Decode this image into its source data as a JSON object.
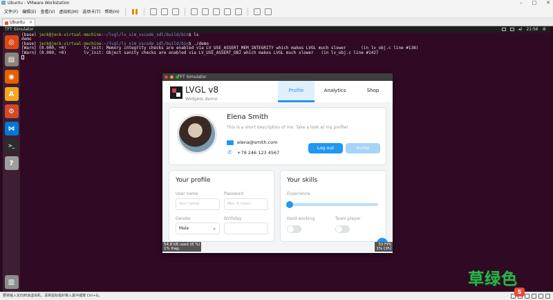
{
  "vmware": {
    "title": "Ubuntu - VMware Workstation",
    "menu": [
      "文件(F)",
      "编辑(E)",
      "查看(V)",
      "虚拟机(M)",
      "选项卡(T)",
      "帮助(H)"
    ],
    "tab_label": "Ubuntu",
    "status_text": "要将输入定向到该虚拟机，请将鼠标指针移入其中或按 Ctrl+G。",
    "watermark": "草绿色",
    "ime_label": "S"
  },
  "ubuntu_panel": {
    "window_title": "TFT Simulator",
    "clock": "21:56"
  },
  "launcher": {
    "items": [
      {
        "name": "ubuntu-dash-icon",
        "color": "#dd4814",
        "glyph": "◎"
      },
      {
        "name": "files-icon",
        "color": "#8c8479",
        "glyph": "▤"
      },
      {
        "name": "firefox-icon",
        "color": "#e66000",
        "glyph": "◉"
      },
      {
        "name": "software-center-icon",
        "color": "#f5a623",
        "glyph": "A"
      },
      {
        "name": "settings-icon",
        "color": "#d14a2a",
        "glyph": "⚙"
      },
      {
        "name": "vscode-icon",
        "color": "#0078d7",
        "glyph": "⋈"
      },
      {
        "name": "terminal-icon",
        "color": "#2c2c2c",
        "glyph": ">_"
      },
      {
        "name": "help-icon",
        "color": "#9e9e9e",
        "glyph": "?"
      }
    ]
  },
  "terminal": {
    "line1_prompt": "(base) ",
    "line1_user": "jeck@jeck-virtual-machine",
    "line1_path": ":~/lvgl/lv_sim_vscode_sdl/build/bin",
    "line1_cmd": "$ ls",
    "line2": "demo",
    "line3_prompt": "(base) ",
    "line3_user": "jeck@jeck-virtual-machine",
    "line3_path": ":~/lvgl/lv_sim_vscode_sdl/build/bin",
    "line3_cmd": "$ ./demo",
    "line4": "[Warn] (0.000, +0)       lv_init: Memory integrity checks are enabled via LV_USE_ASSERT_MEM_INTEGRITY which makes LVGL much slower      (in lv_obj.c line #138)",
    "line5": "[Warn] (0.000, +0)       lv_init: Object sanity checks are enabled via LV_USE_ASSERT_OBJ which makes LVGL much slower   (in lv_obj.c line #142)"
  },
  "simulator": {
    "title": "TFT Simulator",
    "header": {
      "title": "LVGL v8",
      "subtitle": "Widgets demo",
      "tabs": [
        "Profile",
        "Analytics",
        "Shop"
      ]
    },
    "profile": {
      "name": "Elena Smith",
      "description": "This is a short description of me. Take a look at my profile!",
      "email": "elena@smith.com",
      "phone": "+79 246 123 4567",
      "logout_label": "Log out",
      "invite_label": "Invite"
    },
    "your_profile": {
      "title": "Your profile",
      "username_label": "User name",
      "username_placeholder": "Your name",
      "password_label": "Password",
      "password_placeholder": "Min. 8 chars.",
      "gender_label": "Gender",
      "gender_value": "Male",
      "birthday_label": "Birthday"
    },
    "your_skills": {
      "title": "Your skills",
      "experience_label": "Experience",
      "experience_value": 0,
      "hardworking_label": "Hard-working",
      "teamplayer_label": "Team player"
    },
    "perf": {
      "mem": "54.8 kB used (6 %)\n1% frag.",
      "fps": "33 FPS\n1% CPU"
    }
  }
}
